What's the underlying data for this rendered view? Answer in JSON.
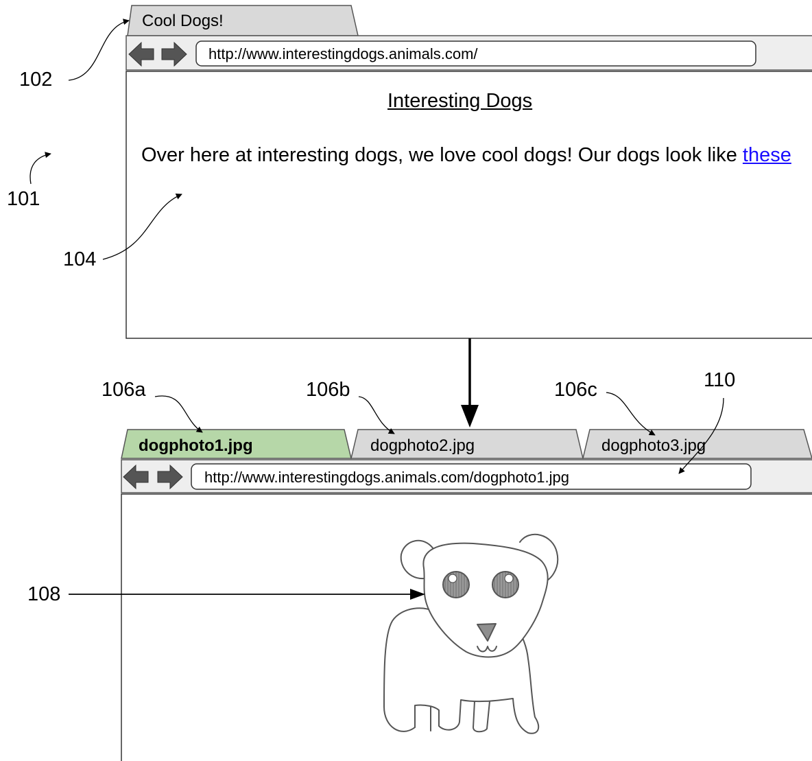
{
  "colors": {
    "line": "#555555",
    "tab_fill": "#d9d9d9",
    "active_tab_fill": "#b6d7a8",
    "toolbar_fill": "#eeeeee",
    "nav_arrow": "#555555",
    "link": "#1a0dff",
    "dog_eye_shading": "#8f8f8f",
    "dog_nose": "#8f8f8f"
  },
  "top_window": {
    "tab_title": "Cool Dogs!",
    "url": "http://www.interestingdogs.animals.com/",
    "page_heading": "Interesting Dogs",
    "paragraph_text": "Over here at interesting dogs, we love cool dogs! Our dogs look like ",
    "link_text": "these",
    "icons": [
      "back-arrow-icon",
      "forward-arrow-icon"
    ]
  },
  "bottom_window": {
    "tabs": [
      {
        "label": "dogphoto1.jpg",
        "active": true
      },
      {
        "label": "dogphoto2.jpg",
        "active": false
      },
      {
        "label": "dogphoto3.jpg",
        "active": false
      }
    ],
    "url": "http://www.interestingdogs.animals.com/dogphoto1.jpg",
    "image": "dog-drawing",
    "icons": [
      "back-arrow-icon",
      "forward-arrow-icon"
    ]
  },
  "reference_numerals": {
    "r101": "101",
    "r102": "102",
    "r104": "104",
    "r106a": "106a",
    "r106b": "106b",
    "r106c": "106c",
    "r108": "108",
    "r110": "110"
  }
}
